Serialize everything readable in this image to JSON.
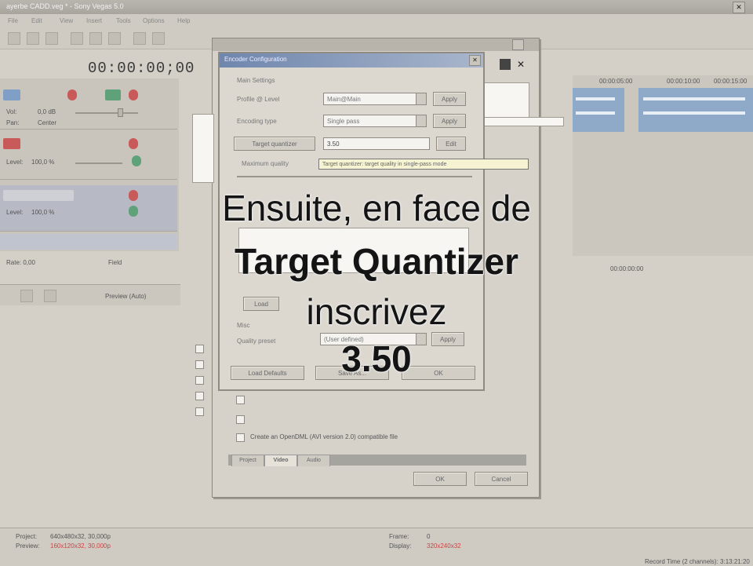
{
  "app": {
    "title": "ayerbe CADD.veg * - Sony Vegas 5.0",
    "menus": [
      "File",
      "Edit",
      "View",
      "Insert",
      "Tools",
      "Options",
      "Help"
    ]
  },
  "timecode": "00:00:00;00",
  "tracks": [
    {
      "vol_label": "Vol:",
      "vol_value": "0,0 dB",
      "pan_label": "Pan:",
      "pan_value": "Center"
    },
    {
      "level_label": "Level:",
      "level_value": "100,0 %"
    },
    {
      "level_label": "Level:",
      "level_value": "100,0 %"
    }
  ],
  "left_misc": {
    "rate": "Rate: 0,00",
    "field": "Field",
    "preview": "Preview (Auto)"
  },
  "timeline": {
    "markers": [
      "00:00:05:00",
      "00:00:10:00",
      "00:00:15:00"
    ],
    "time_readout": "00:00:00:00"
  },
  "encoder_dialog": {
    "title": "Encoder Configuration",
    "group_main": "Main Settings",
    "rows": [
      {
        "label": "Profile @ Level",
        "value": "Main@Main",
        "button": "Apply"
      },
      {
        "label": "Encoding type",
        "value": "Single pass",
        "button": "Apply"
      },
      {
        "label": "Target quantizer",
        "value": "3.50",
        "button": "Edit"
      },
      {
        "label": "Maximum quality",
        "value": "",
        "button": ""
      }
    ],
    "tooltip": "Target quantizer: target quality in single-pass mode",
    "misc_label": "Misc",
    "quality_label": "Quality preset",
    "quality_value": "(User defined)",
    "quality_button": "Apply",
    "load_defaults": "Load Defaults",
    "save_button": "Save As...",
    "ok_button": "OK",
    "left_button": "Load"
  },
  "main_window": {
    "checkbox_label": "Create an OpenDML (AVI version 2.0) compatible file",
    "tabs": [
      "Project",
      "Video",
      "Audio"
    ],
    "ok": "OK",
    "cancel": "Cancel"
  },
  "overlay": {
    "line1": "Ensuite, en face de",
    "line2": "Target Quantizer",
    "line3": "inscrivez",
    "line4": "3.50"
  },
  "status": {
    "project_label": "Project:",
    "project_value": "640x480x32, 30,000p",
    "preview_label": "Preview:",
    "preview_value": "160x120x32, 30,000p",
    "frame_label": "Frame:",
    "frame_value": "0",
    "display_label": "Display:",
    "display_value": "320x240x32",
    "record_time": "Record Time (2 channels): 3:13:21:20"
  },
  "colors": {
    "accent_blue": "#6f86ad",
    "audio_clip": "#8fa9c8",
    "track_red": "#c95a5a",
    "track_green": "#5fa27a"
  }
}
